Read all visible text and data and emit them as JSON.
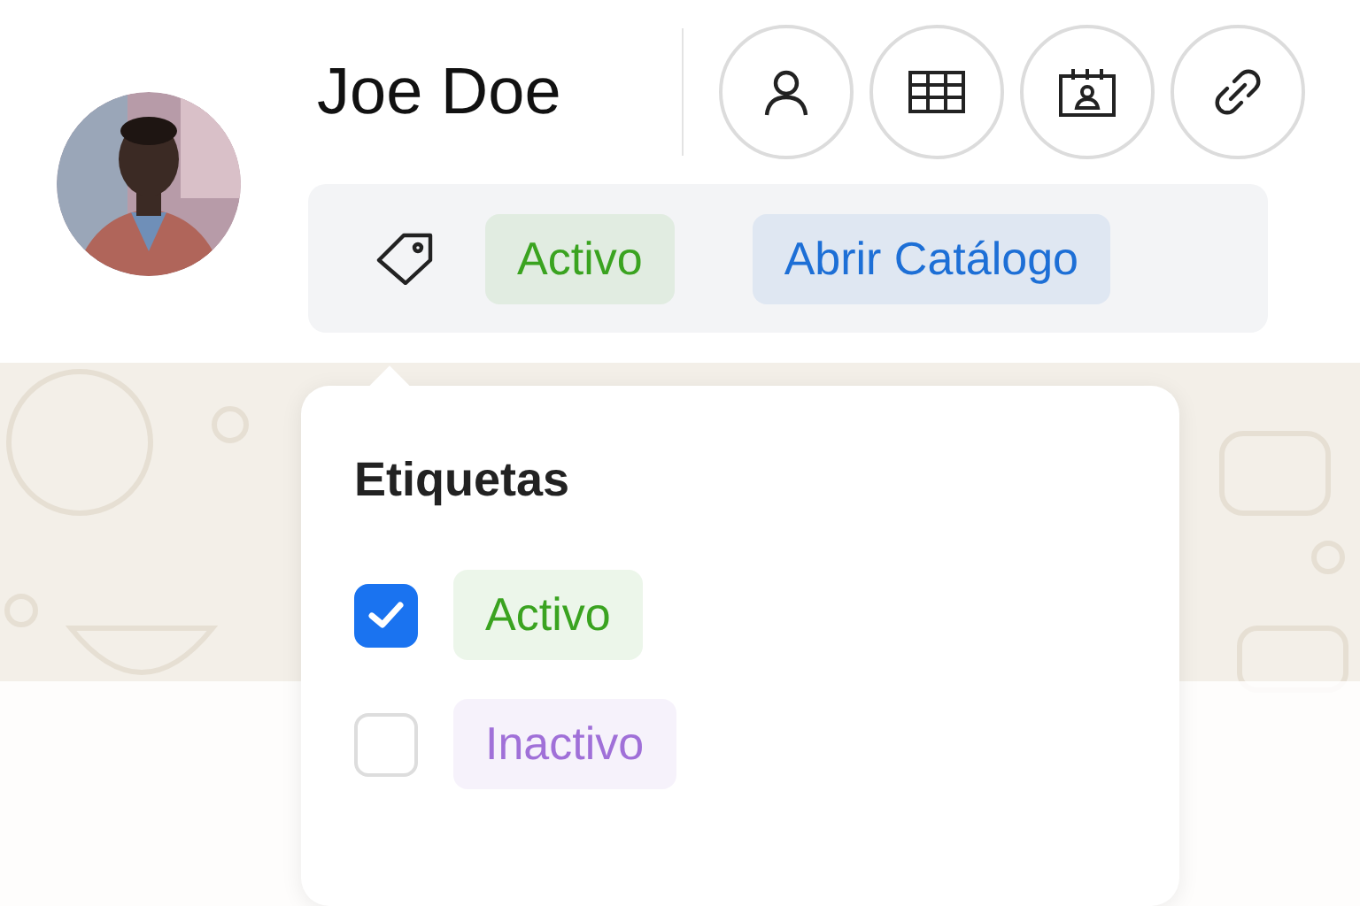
{
  "contact": {
    "name": "Joe Doe"
  },
  "actions": [
    {
      "kind": "person"
    },
    {
      "kind": "table"
    },
    {
      "kind": "calendar"
    },
    {
      "kind": "link"
    }
  ],
  "tag_bar": {
    "tags": [
      {
        "label": "Activo",
        "color": "#3aa320"
      },
      {
        "label": "Abrir Catálogo",
        "color": "#1d6fd6"
      }
    ]
  },
  "popover": {
    "title": "Etiquetas",
    "options": [
      {
        "label": "Activo",
        "color": "#3aa320",
        "checked": true
      },
      {
        "label": "Inactivo",
        "color": "#a070d8",
        "checked": false
      }
    ]
  }
}
